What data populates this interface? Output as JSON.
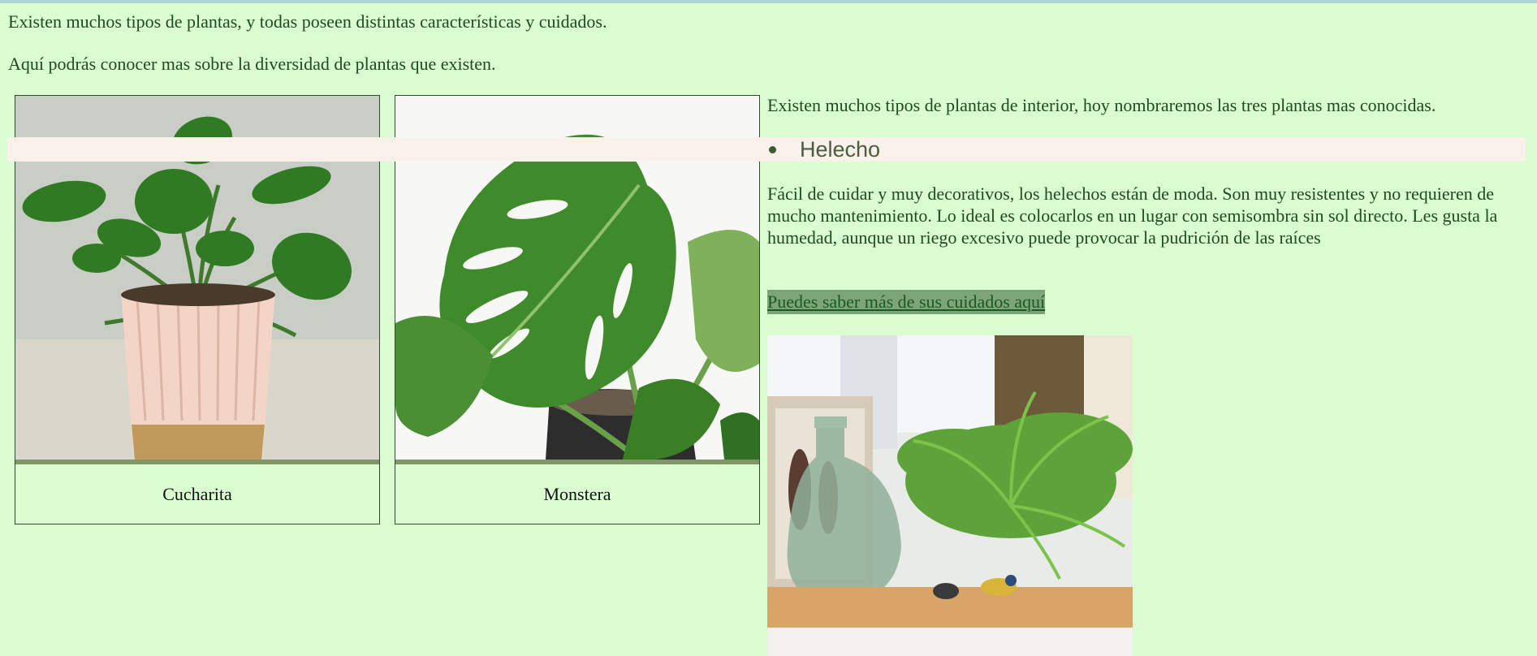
{
  "intro": {
    "line1": "Existen muchos tipos de plantas, y todas poseen distintas características y cuidados.",
    "line2": "Aquí podrás conocer mas sobre la diversidad de plantas que existen."
  },
  "cards": [
    {
      "caption": "Cucharita"
    },
    {
      "caption": "Monstera"
    }
  ],
  "right": {
    "lead": "Existen muchos tipos de plantas de interior, hoy nombraremos las tres plantas mas conocidas.",
    "bullet": "Helecho",
    "description": "Fácil de cuidar y muy decorativos, los helechos están de moda. Son muy resistentes y no requieren de mucho mantenimiento. Lo ideal es colocarlos en un lugar con semisombra sin sol directo. Les gusta la humedad, aunque un riego excesivo puede provocar la pudrición de las raíces",
    "link": "Puedes saber más de sus cuidados aquí"
  },
  "colors": {
    "background": "#dbfdd2",
    "text": "#1d4a1f",
    "bullet_band": "#faf2ea",
    "link_bg": "#7ea57a",
    "card_separator": "#7f9668"
  }
}
